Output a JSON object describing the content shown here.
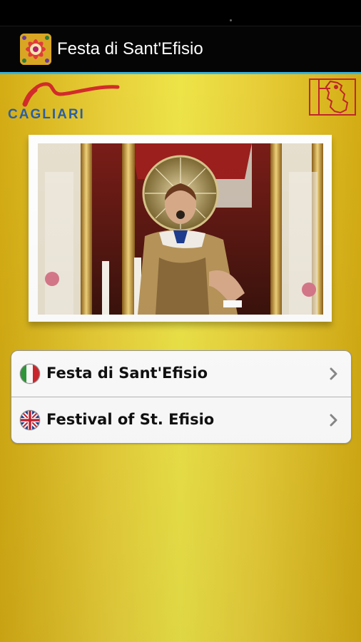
{
  "app": {
    "title": "Festa di Sant'Efisio",
    "icon": "festival-flower-icon"
  },
  "header_logo": {
    "text": "CAGLIARI",
    "brand_color": "#2b5fa6",
    "swoosh_color": "#d22b2b"
  },
  "map_button": {
    "icon": "sardinia-map-icon",
    "color": "#c0262c"
  },
  "photo": {
    "subject": "statue-photo"
  },
  "menu": {
    "items": [
      {
        "label": "Festa di Sant'Efisio",
        "flag": "italy-flag-icon"
      },
      {
        "label": "Festival of St. Efisio",
        "flag": "uk-flag-icon"
      }
    ]
  },
  "colors": {
    "accent": "#33b5e5",
    "background_gold": "#e8cf3a"
  }
}
